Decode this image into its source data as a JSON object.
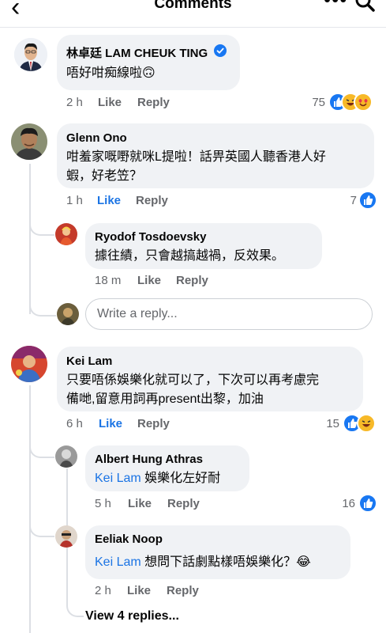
{
  "header": {
    "back_glyph": "‹",
    "title": "Comments",
    "more_glyph": "•••"
  },
  "comments": [
    {
      "name": "林卓廷 LAM CHEUK TING",
      "text": "唔好咁痴線啦🙃",
      "time": "2 h",
      "like": "Like",
      "reply": "Reply",
      "reactions": "75"
    },
    {
      "name": "Glenn Ono",
      "text_line1": "咁羞家嘅嘢就咪L提啦！話畀英國人聽香港人好",
      "text_line2": "蝦，好老笠？",
      "time": "1 h",
      "like": "Like",
      "reply": "Reply",
      "reactions": "7"
    },
    {
      "name": "Ryodof Tosdoevsky",
      "text": "據往績，只會越搞越禍，反效果。",
      "time": "18 m",
      "like": "Like",
      "reply": "Reply"
    },
    {
      "name": "Kei Lam",
      "text_line1": "只要唔係娛樂化就可以了，下次可以再考慮完",
      "text_line2": "備哋,留意用詞再present出黎，加油",
      "time": "6 h",
      "like": "Like",
      "reply": "Reply",
      "reactions": "15"
    },
    {
      "name": "Albert Hung Athras",
      "mention": "Kei Lam",
      "text": " 娛樂化左好耐",
      "time": "5 h",
      "like": "Like",
      "reply": "Reply",
      "reactions": "16"
    },
    {
      "name": "Eeliak Noop",
      "mention": "Kei Lam",
      "text": " 想問下話劇點樣唔娛樂化？😂",
      "time": "2 h",
      "like": "Like",
      "reply": "Reply"
    }
  ],
  "reply_input": {
    "placeholder": "Write a reply..."
  },
  "view_more": "View 4 replies...",
  "colors": {
    "link_blue": "#1b74e4",
    "bubble": "#f0f2f5",
    "meta_grey": "#65676b",
    "verified": "#1877f2"
  }
}
